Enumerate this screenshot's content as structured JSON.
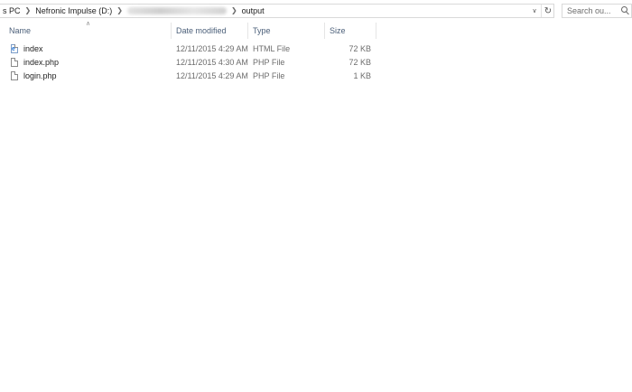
{
  "address_bar": {
    "crumbs": [
      "s PC",
      "Nefronic Impulse (D:)",
      "output"
    ],
    "blurred_crumb_present": true
  },
  "search": {
    "placeholder": "Search ou..."
  },
  "columns": {
    "name": "Name",
    "date": "Date modified",
    "type": "Type",
    "size": "Size"
  },
  "files": [
    {
      "name": "index",
      "date": "12/11/2015 4:29 AM",
      "type": "HTML File",
      "size": "72 KB",
      "icon": "html-file-icon"
    },
    {
      "name": "index.php",
      "date": "12/11/2015 4:30 AM",
      "type": "PHP File",
      "size": "72 KB",
      "icon": "file-icon"
    },
    {
      "name": "login.php",
      "date": "12/11/2015 4:29 AM",
      "type": "PHP File",
      "size": "1 KB",
      "icon": "file-icon"
    }
  ],
  "icons": {
    "sort": "sort-ascending-icon",
    "dropdown": "chevron-down-icon",
    "refresh": "refresh-icon",
    "search": "search-icon",
    "separator": "chevron-right-icon"
  }
}
